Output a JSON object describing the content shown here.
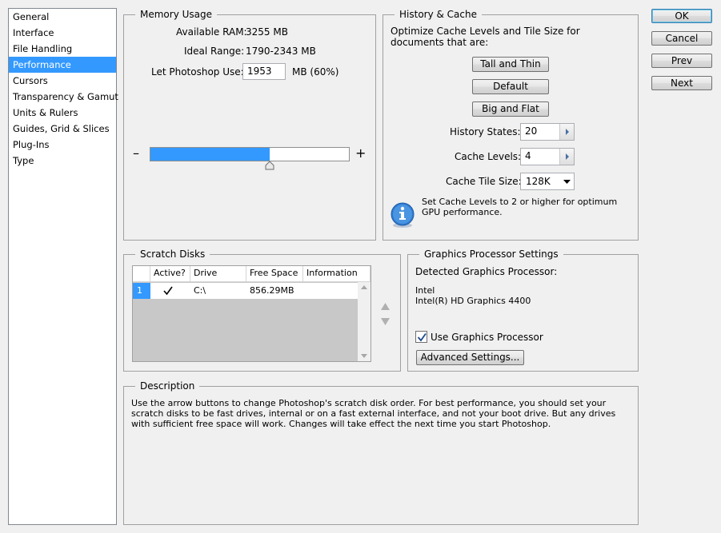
{
  "sidebar": {
    "items": [
      {
        "label": "General",
        "selected": false
      },
      {
        "label": "Interface",
        "selected": false
      },
      {
        "label": "File Handling",
        "selected": false
      },
      {
        "label": "Performance",
        "selected": true
      },
      {
        "label": "Cursors",
        "selected": false
      },
      {
        "label": "Transparency & Gamut",
        "selected": false
      },
      {
        "label": "Units & Rulers",
        "selected": false
      },
      {
        "label": "Guides, Grid & Slices",
        "selected": false
      },
      {
        "label": "Plug-Ins",
        "selected": false
      },
      {
        "label": "Type",
        "selected": false
      }
    ]
  },
  "memory": {
    "title": "Memory Usage",
    "available_label": "Available RAM:",
    "available_value": "3255 MB",
    "ideal_label": "Ideal Range:",
    "ideal_value": "1790-2343 MB",
    "let_label": "Let Photoshop Use:",
    "let_value": "1953",
    "let_unit": "MB (60%)",
    "minus": "–",
    "plus": "+",
    "slider_fraction": 0.6
  },
  "history": {
    "title": "History & Cache",
    "optimize_text": "Optimize Cache Levels and Tile Size for documents that are:",
    "btn_tall": "Tall and Thin",
    "btn_default": "Default",
    "btn_big": "Big and Flat",
    "states_label": "History States:",
    "states_value": "20",
    "levels_label": "Cache Levels:",
    "levels_value": "4",
    "tile_label": "Cache Tile Size:",
    "tile_value": "128K",
    "info_text": "Set Cache Levels to 2 or higher for optimum GPU performance.",
    "info_icon": "info-icon"
  },
  "scratch": {
    "title": "Scratch Disks",
    "columns": [
      "Active?",
      "Drive",
      "Free Space",
      "Information"
    ],
    "rows": [
      {
        "index": "1",
        "active": true,
        "drive": "C:\\",
        "free": "856.29MB",
        "info": ""
      }
    ]
  },
  "gpu": {
    "title": "Graphics Processor Settings",
    "detected_label": "Detected Graphics Processor:",
    "vendor": "Intel",
    "model": "Intel(R) HD Graphics 4400",
    "use_label": "Use Graphics Processor",
    "use_checked": true,
    "advanced_button": "Advanced Settings..."
  },
  "description": {
    "title": "Description",
    "text": "Use the arrow buttons to change Photoshop's scratch disk order. For best performance, you should set your scratch disks to be fast drives, internal or on a fast external interface, and not your boot drive. But any drives with sufficient free space will work. Changes will take effect the next time you start Photoshop."
  },
  "dialog_buttons": {
    "ok": "OK",
    "cancel": "Cancel",
    "prev": "Prev",
    "next": "Next"
  },
  "colors": {
    "selection": "#3399ff",
    "slider_fill": "#3399ff"
  }
}
